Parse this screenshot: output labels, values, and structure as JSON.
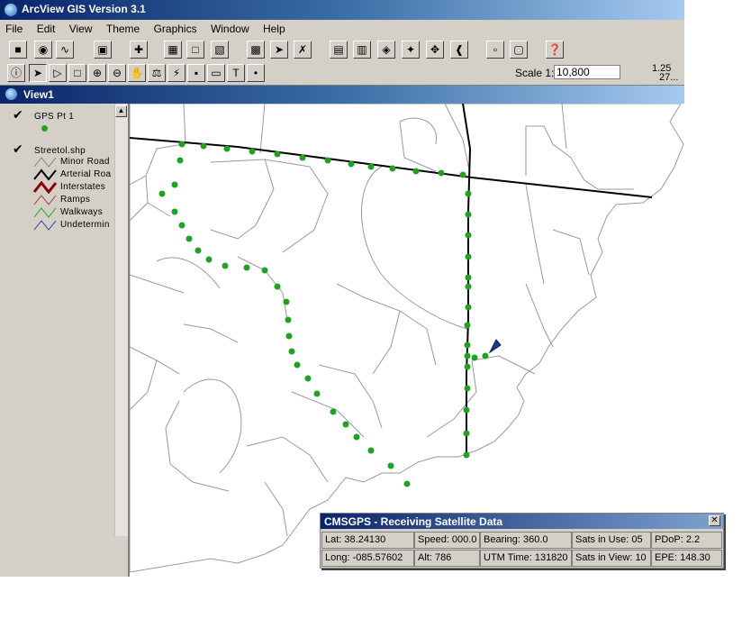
{
  "app": {
    "title": "ArcView GIS Version 3.1"
  },
  "menu": [
    "File",
    "Edit",
    "View",
    "Theme",
    "Graphics",
    "Window",
    "Help"
  ],
  "toolbar": {
    "scale_label": "Scale 1:",
    "scale_value": "10,800",
    "coord_x": "1.25",
    "coord_y": "27..."
  },
  "view": {
    "title": "View1"
  },
  "toc": {
    "layers": [
      {
        "name": "GPS Pt 1",
        "checked": true
      },
      {
        "name": "Streetol.shp",
        "checked": true
      }
    ],
    "legend": [
      {
        "label": "Minor Road",
        "color": "#808080"
      },
      {
        "label": "Arterial Roa",
        "color": "#000000"
      },
      {
        "label": "Interstates",
        "color": "#8b0000"
      },
      {
        "label": "Ramps",
        "color": "#b03030"
      },
      {
        "label": "Walkways",
        "color": "#1fa31f"
      },
      {
        "label": "Undetermin",
        "color": "#2a3ca0"
      }
    ]
  },
  "gps_panel": {
    "title": "CMSGPS - Receiving Satellite Data",
    "row1": [
      "Lat: 38.24130",
      "Speed: 000.0",
      "Bearing: 360.0",
      "Sats in Use: 05",
      "PDoP: 2.2"
    ],
    "row2": [
      "Long: -085.57602",
      "Alt: 786",
      "UTM Time: 131820",
      "Sats in View: 10",
      "EPE: 148.30"
    ]
  },
  "colors": {
    "gps_point": "#1fa31f",
    "arterial": "#000000",
    "minor_road": "#808080",
    "marker": "#1a3a8a"
  }
}
